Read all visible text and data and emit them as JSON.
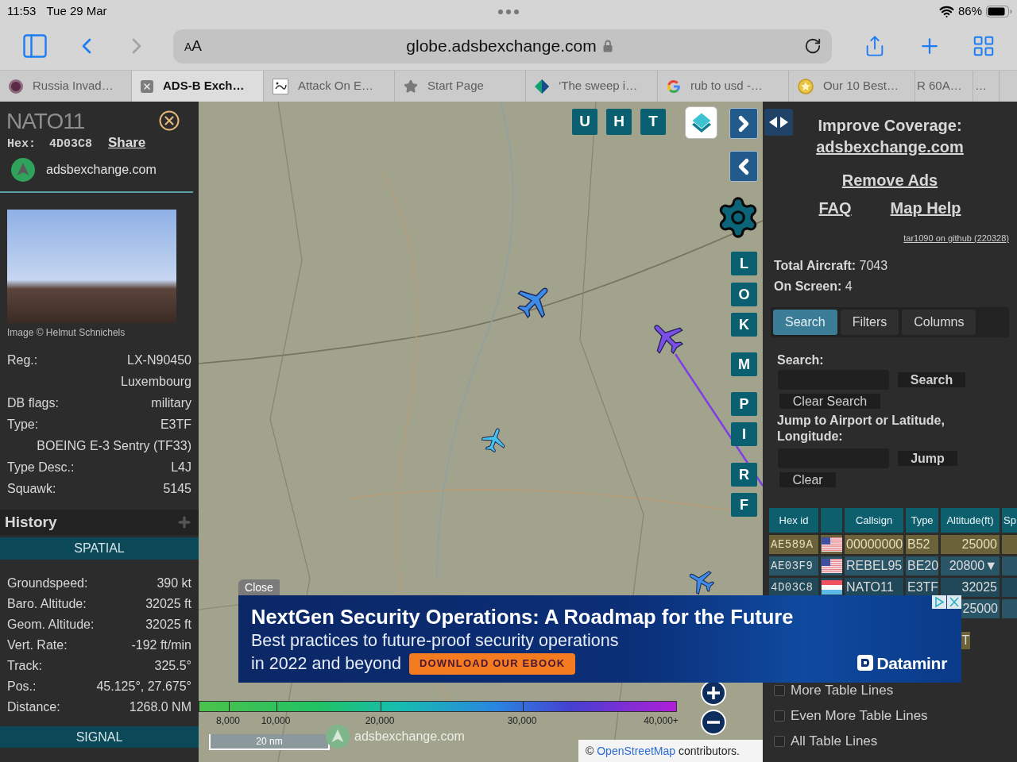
{
  "status_bar": {
    "time": "11:53",
    "date": "Tue 29 Mar",
    "battery": "86%"
  },
  "browser": {
    "text_size": "AA",
    "url": "globe.adsbexchange.com",
    "forward_disabled": true,
    "tabs": [
      {
        "title": "Russia Invad…",
        "kind": "avatar",
        "selected": false
      },
      {
        "title": "ADS-B Exch…",
        "kind": "close",
        "selected": true
      },
      {
        "title": "Attack On E…",
        "kind": "image",
        "selected": false
      },
      {
        "title": "Start Page",
        "kind": "star",
        "selected": false
      },
      {
        "title": "‘The sweep i…",
        "kind": "diamond",
        "selected": false
      },
      {
        "title": "rub to usd -…",
        "kind": "google",
        "selected": false
      },
      {
        "title": "Our 10 Best…",
        "kind": "badge",
        "selected": false
      },
      {
        "title": "R 60A…",
        "kind": "none",
        "selected": false
      },
      {
        "title": "…",
        "kind": "none",
        "selected": false
      }
    ]
  },
  "aircraft_panel": {
    "callsign": "NATO11",
    "hex_label": "Hex:",
    "hex": "4D03C8",
    "share": "Share",
    "site": "adsbexchange.com",
    "photo_credit": "Image © Helmut Schnichels",
    "details": [
      {
        "label": "Reg.:",
        "value": "LX-N90450"
      },
      {
        "value": "Luxembourg"
      },
      {
        "label": "DB flags:",
        "value": "military"
      },
      {
        "label": "Type:",
        "value": "E3TF"
      },
      {
        "value": "BOEING E-3 Sentry (TF33)"
      },
      {
        "label": "Type Desc.:",
        "value": "L4J"
      },
      {
        "label": "Squawk:",
        "value": "5145"
      }
    ],
    "history": "History",
    "sections": [
      {
        "title": "SPATIAL",
        "rows": [
          {
            "label": "Groundspeed:",
            "value": "390 kt"
          },
          {
            "label": "Baro. Altitude:",
            "value": "32025 ft"
          },
          {
            "label": "Geom. Altitude:",
            "value": "32025 ft"
          },
          {
            "label": "Vert. Rate:",
            "value": "-192 ft/min"
          },
          {
            "label": "Track:",
            "value": "325.5°"
          },
          {
            "label": "Pos.:",
            "value": "45.125°, 27.675°"
          },
          {
            "label": "Distance:",
            "value": "1268.0 NM"
          }
        ]
      },
      {
        "title": "SIGNAL"
      }
    ]
  },
  "map": {
    "toggle_buttons": [
      "U",
      "H",
      "T"
    ],
    "side_buttons": [
      "L",
      "O",
      "K",
      "M",
      "P",
      "I",
      "R",
      "F"
    ],
    "aircraft": [
      {
        "color": "#3d8be8"
      },
      {
        "color": "#7b4fe6"
      },
      {
        "color": "#45c3ee"
      },
      {
        "color": "#3d8be8"
      }
    ],
    "altitude_legend": [
      "8,000",
      "10,000",
      "20,000",
      "30,000",
      "40,000+"
    ],
    "scale": "20 nm",
    "logo_text": "adsbexchange.com",
    "attribution": {
      "symbol": "©",
      "link": "OpenStreetMap",
      "text": "contributors."
    }
  },
  "sidebar": {
    "coverage_title": "Improve Coverage:",
    "coverage_link": "adsbexchange.com",
    "remove_ads": "Remove Ads",
    "links": [
      "FAQ",
      "Map Help"
    ],
    "version": "tar1090 on github (220328)",
    "total": "**Total Aircraft:** 7043",
    "on_screen": "**On Screen:** 4",
    "tabs": [
      {
        "label": "Search",
        "selected": true
      },
      {
        "label": "Filters",
        "selected": false
      },
      {
        "label": "Columns",
        "selected": false
      }
    ],
    "search": {
      "label": "Search:",
      "button": "Search",
      "clear": "Clear Search"
    },
    "jump": {
      "label": "Jump to Airport or Latitude, Longitude:",
      "button": "Jump",
      "clear": "Clear"
    },
    "table": {
      "columns": [
        {
          "kind": "text",
          "label": "Hex id"
        },
        {
          "kind": "flag"
        },
        {
          "kind": "text",
          "label": "Callsign"
        },
        {
          "kind": "text",
          "label": "Type"
        },
        {
          "kind": "text",
          "label": "Altitude(ft)"
        },
        {
          "kind": "text",
          "label": "Sp"
        }
      ],
      "rows": [
        {
          "hex": "AE589A",
          "flag": {
            "kind": "us"
          },
          "callsign": "00000000",
          "type": "B52",
          "altitude": "25000",
          "highlighted": true
        },
        {
          "hex": "AE03F9",
          "flag": {
            "kind": "us"
          },
          "callsign": "REBEL95",
          "type": "BE20",
          "altitude": "20800▼",
          "highlighted": false
        },
        {
          "hex": "4D03C8",
          "flag": {
            "kind": "lu"
          },
          "callsign": "NATO11",
          "type": "E3TF",
          "altitude": "32025",
          "highlighted": false
        },
        {
          "altitude": "25000",
          "highlighted": false
        }
      ]
    },
    "partial_button": "T",
    "options": [
      {
        "label": "More Table Lines",
        "checked": false
      },
      {
        "label": "Even More Table Lines",
        "checked": false
      },
      {
        "label": "All Table Lines",
        "checked": false
      }
    ]
  },
  "ad": {
    "close": "Close",
    "title": "NextGen Security Operations: A Roadmap for the Future",
    "lines": [
      "Best practices to future-proof security operations",
      "in 2022 and beyond"
    ],
    "cta": "DOWNLOAD OUR EBOOK",
    "brand": "Dataminr"
  }
}
